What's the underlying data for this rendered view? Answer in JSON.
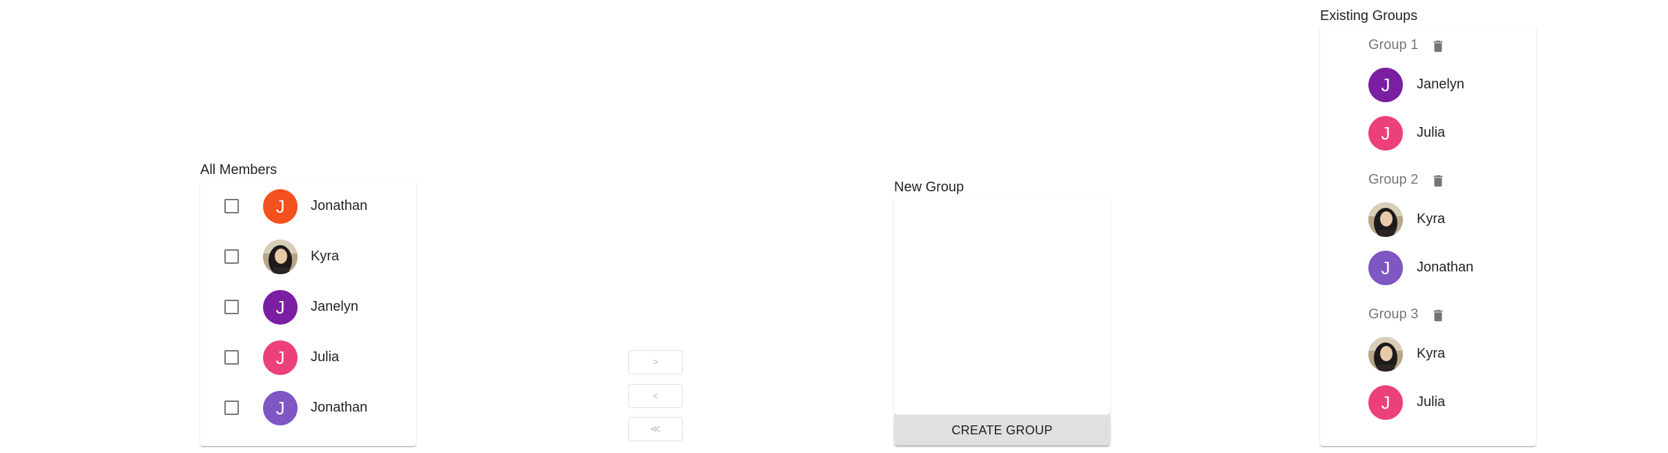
{
  "all_members": {
    "title": "All Members",
    "items": [
      {
        "name": "Jonathan",
        "initial": "J",
        "color": "#f4511e",
        "photo": false
      },
      {
        "name": "Kyra",
        "initial": "",
        "color": "#c9b79a",
        "photo": true
      },
      {
        "name": "Janelyn",
        "initial": "J",
        "color": "#7b1fa2",
        "photo": false
      },
      {
        "name": "Julia",
        "initial": "J",
        "color": "#ec407a",
        "photo": false
      },
      {
        "name": "Jonathan",
        "initial": "J",
        "color": "#7e57c2",
        "photo": false
      }
    ]
  },
  "transfer": {
    "move_right_label": ">",
    "move_left_label": "<",
    "move_all_left_label": "≪"
  },
  "new_group": {
    "title": "New Group",
    "create_button_label": "CREATE GROUP"
  },
  "existing_groups": {
    "title": "Existing Groups",
    "groups": [
      {
        "name": "Group 1",
        "members": [
          {
            "name": "Janelyn",
            "initial": "J",
            "color": "#7b1fa2",
            "photo": false
          },
          {
            "name": "Julia",
            "initial": "J",
            "color": "#ec407a",
            "photo": false
          }
        ]
      },
      {
        "name": "Group 2",
        "members": [
          {
            "name": "Kyra",
            "initial": "",
            "color": "#c9b79a",
            "photo": true
          },
          {
            "name": "Jonathan",
            "initial": "J",
            "color": "#7e57c2",
            "photo": false
          }
        ]
      },
      {
        "name": "Group 3",
        "members": [
          {
            "name": "Kyra",
            "initial": "",
            "color": "#c9b79a",
            "photo": true
          },
          {
            "name": "Julia",
            "initial": "J",
            "color": "#ec407a",
            "photo": false
          }
        ]
      }
    ]
  }
}
